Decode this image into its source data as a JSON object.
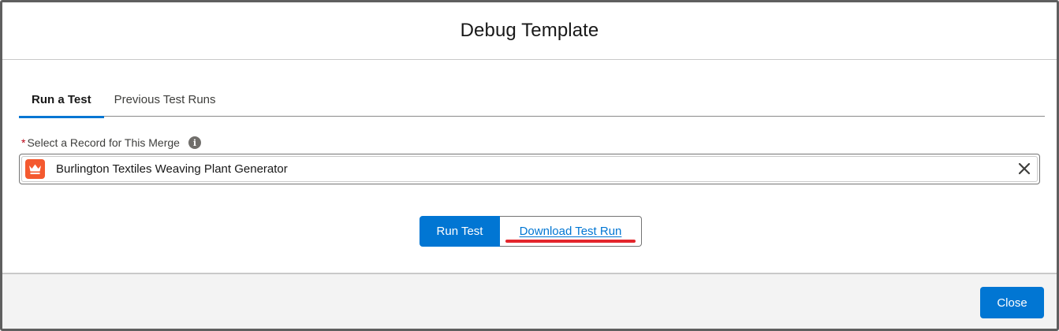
{
  "modal": {
    "title": "Debug Template"
  },
  "tabs": [
    {
      "label": "Run a Test",
      "active": true
    },
    {
      "label": "Previous Test Runs",
      "active": false
    }
  ],
  "field": {
    "required_marker": "*",
    "label": "Select a Record for This Merge",
    "info_icon": "i",
    "value": "Burlington Textiles Weaving Plant Generator",
    "record_icon": "crown-icon",
    "clear_icon": "close-icon"
  },
  "actions": {
    "run_label": "Run Test",
    "download_label": "Download Test Run"
  },
  "footer": {
    "close_label": "Close"
  },
  "colors": {
    "brand": "#0176d3",
    "record_icon_bg": "#f4592f",
    "annotation_red": "#e3262c",
    "required": "#ba0517"
  }
}
